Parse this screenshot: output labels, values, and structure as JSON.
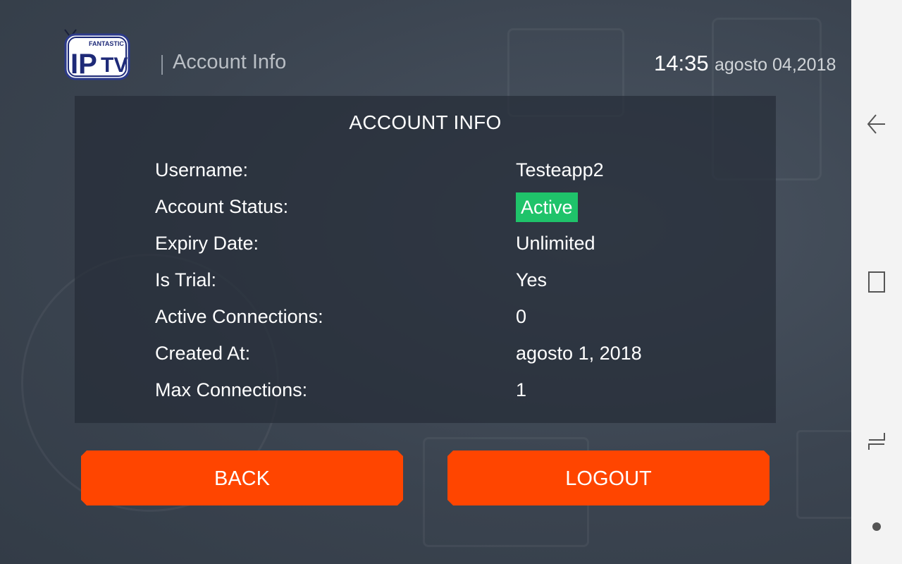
{
  "header": {
    "logo_icon": "iptv-logo",
    "section_title": "Account Info",
    "time": "14:35",
    "date": "agosto 04,2018"
  },
  "panel": {
    "title": "ACCOUNT INFO",
    "rows": [
      {
        "label": "Username:",
        "value": "Testeapp2"
      },
      {
        "label": "Account Status:",
        "value": "Active"
      },
      {
        "label": "Expiry Date:",
        "value": "Unlimited"
      },
      {
        "label": "Is Trial:",
        "value": "Yes"
      },
      {
        "label": "Active Connections:",
        "value": "0"
      },
      {
        "label": "Created At:",
        "value": "agosto 1, 2018"
      },
      {
        "label": "Max Connections:",
        "value": "1"
      }
    ]
  },
  "buttons": {
    "back": "BACK",
    "logout": "LOGOUT"
  },
  "navbar": {
    "icons": [
      "back-icon",
      "home-icon",
      "recent-apps-icon",
      "dot-icon"
    ]
  },
  "colors": {
    "accent": "#ff4500",
    "status_active": "#1fc36a",
    "background": "#3b4450"
  }
}
